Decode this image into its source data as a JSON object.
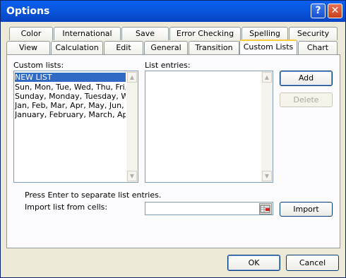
{
  "window": {
    "title": "Options",
    "help_glyph": "?",
    "close_glyph": "✕"
  },
  "tabs_back": [
    "Color",
    "International",
    "Save",
    "Error Checking",
    "Spelling",
    "Security"
  ],
  "tabs_front": [
    "View",
    "Calculation",
    "Edit",
    "General",
    "Transition",
    "Custom Lists",
    "Chart"
  ],
  "active_tab": "Custom Lists",
  "custom_lists": {
    "label": "Custom lists:",
    "items": [
      "NEW LIST",
      "Sun, Mon, Tue, Wed, Thu, Fri, Sat",
      "Sunday, Monday, Tuesday, Wednesday, Thursday, Friday, Saturday",
      "Jan, Feb, Mar, Apr, May, Jun, Jul, Aug, Sep, Oct, Nov, Dec",
      "January, February, March, April, May, June, July, August, September, October, November, December"
    ],
    "selected_index": 0
  },
  "list_entries": {
    "label": "List entries:",
    "value": ""
  },
  "buttons": {
    "add": "Add",
    "delete": "Delete",
    "import": "Import",
    "ok": "OK",
    "cancel": "Cancel"
  },
  "hint": "Press Enter to separate list entries.",
  "import_label": "Import list from cells:",
  "import_value": "",
  "scroll": {
    "up": "▲",
    "down": "▼"
  },
  "colors": {
    "title_bar": "#0A5FEF",
    "selection": "#316AC5",
    "dialog_bg": "#ECE9D8",
    "active_tab_accent": "#FFC83C"
  }
}
